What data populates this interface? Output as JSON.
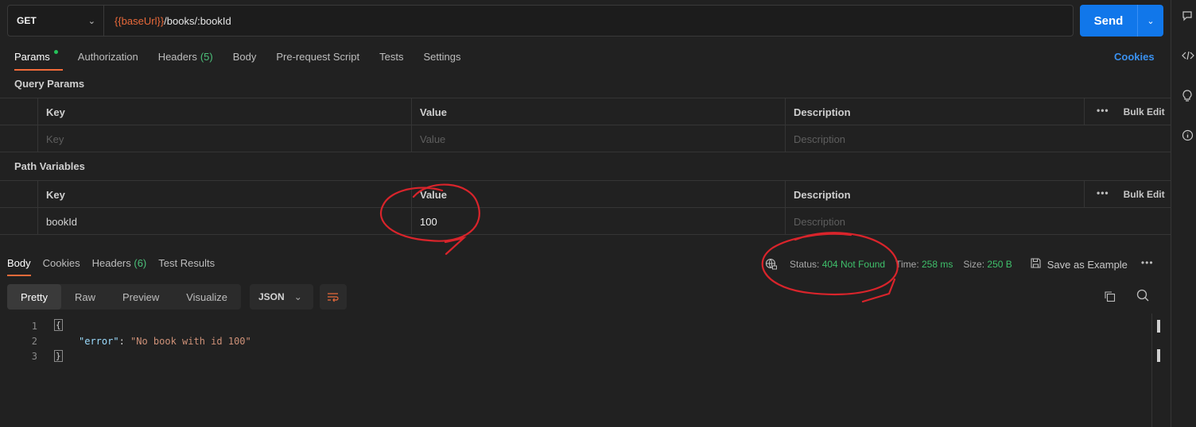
{
  "request": {
    "method": "GET",
    "url_var": "{{baseUrl}}",
    "url_path": "/books/:bookId",
    "send_label": "Send"
  },
  "request_tabs": [
    {
      "label": "Params",
      "count": "",
      "active": true
    },
    {
      "label": "Authorization",
      "count": ""
    },
    {
      "label": "Headers",
      "count": "(5)"
    },
    {
      "label": "Body",
      "count": ""
    },
    {
      "label": "Pre-request Script",
      "count": ""
    },
    {
      "label": "Tests",
      "count": ""
    },
    {
      "label": "Settings",
      "count": ""
    }
  ],
  "cookies_link": "Cookies",
  "query_params": {
    "title": "Query Params",
    "headers": {
      "key": "Key",
      "value": "Value",
      "description": "Description",
      "bulk": "Bulk Edit"
    },
    "placeholder": {
      "key": "Key",
      "value": "Value",
      "description": "Description"
    }
  },
  "path_variables": {
    "title": "Path Variables",
    "headers": {
      "key": "Key",
      "value": "Value",
      "description": "Description",
      "bulk": "Bulk Edit"
    },
    "rows": [
      {
        "key": "bookId",
        "value": "100",
        "description_placeholder": "Description"
      }
    ]
  },
  "response_tabs": [
    {
      "label": "Body",
      "count": "",
      "active": true
    },
    {
      "label": "Cookies",
      "count": ""
    },
    {
      "label": "Headers",
      "count": "(6)"
    },
    {
      "label": "Test Results",
      "count": ""
    }
  ],
  "status": {
    "status_label": "Status:",
    "status_value": "404 Not Found",
    "time_label": "Time:",
    "time_value": "258 ms",
    "size_label": "Size:",
    "size_value": "250 B",
    "save_example": "Save as Example"
  },
  "view_modes": [
    "Pretty",
    "Raw",
    "Preview",
    "Visualize"
  ],
  "format": "JSON",
  "code": {
    "line_numbers": [
      "1",
      "2",
      "3"
    ],
    "open_brace": "{",
    "key": "\"error\"",
    "colon": ": ",
    "value": "\"No book with id 100\"",
    "close_brace": "}"
  },
  "icons": {
    "method_chevron": "chevron-down-icon",
    "send_chevron": "chevron-down-icon",
    "globe": "globe-icon",
    "save": "save-icon",
    "more": "more-horizontal-icon",
    "copy": "copy-icon",
    "search": "search-icon",
    "wrap": "wrap-lines-icon"
  },
  "colors": {
    "accent": "#f26b3a",
    "send": "#1177ea",
    "status_green": "#3fc06b",
    "link_blue": "#3a91f0",
    "annotation_red": "#d9242b"
  }
}
